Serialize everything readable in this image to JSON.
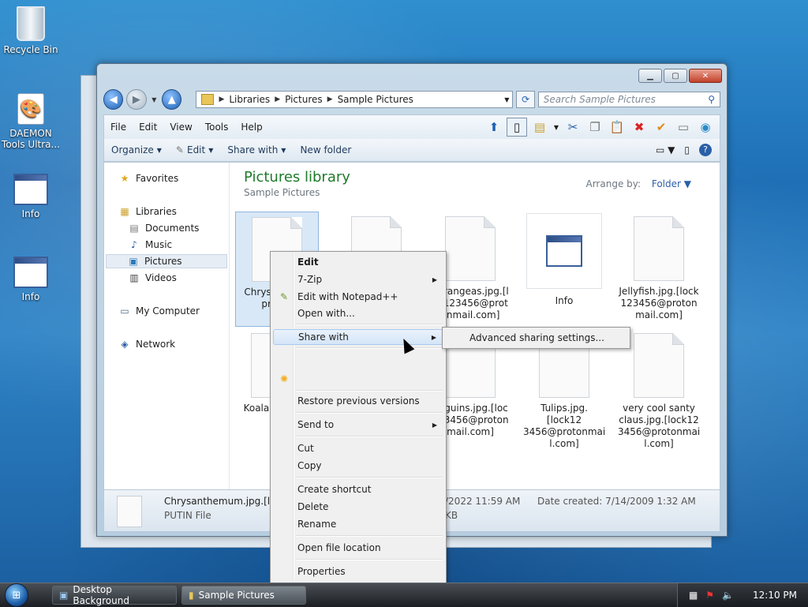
{
  "desktop": {
    "icons": [
      {
        "label": "Recycle Bin"
      },
      {
        "label": "DAEMON Tools Ultra..."
      },
      {
        "label": "Info"
      },
      {
        "label": "Info"
      }
    ]
  },
  "window": {
    "address": {
      "crumbs": [
        "Libraries",
        "Pictures",
        "Sample Pictures"
      ]
    },
    "search_placeholder": "Search Sample Pictures",
    "menu": [
      "File",
      "Edit",
      "View",
      "Tools",
      "Help"
    ],
    "commands": {
      "organize": "Organize",
      "edit": "Edit",
      "share": "Share with",
      "new_folder": "New folder"
    },
    "nav": {
      "favorites": "Favorites",
      "libraries": "Libraries",
      "documents": "Documents",
      "music": "Music",
      "pictures": "Pictures",
      "videos": "Videos",
      "computer": "My Computer",
      "network": "Network"
    },
    "library_title": "Pictures library",
    "library_sub": "Sample Pictures",
    "arrange_label": "Arrange by:",
    "arrange_value": "Folder",
    "files": {
      "chrys": "Chrysa jpg.[lo proton",
      "hydr": "ydrangeas.jpg.[l ck123456@prot onmail.com]",
      "info": "Info",
      "jelly": "Jellyfish.jpg.[lock 123456@proton mail.com]",
      "koala": "Koala. 3456@",
      "peng": "enguins.jpg.[loc 123456@proton mail.com]",
      "tulips": "Tulips.jpg.[lock12 3456@protonmai l.com]",
      "santa": "very cool santy claus.jpg.[lock12 3456@protonmai l.com]"
    },
    "details": {
      "name": "Chrysanthemum.jpg.[loc",
      "type": "PUTIN File",
      "modified": "/2022 11:59 AM",
      "size": "KB",
      "created": "Date created:  7/14/2009 1:32 AM"
    }
  },
  "context_menu": {
    "edit": "Edit",
    "zip": "7-Zip",
    "notepad": "Edit with Notepad++",
    "open_with": "Open with...",
    "share_with": "Share with",
    "restore": "Restore previous versions",
    "send_to": "Send to",
    "cut": "Cut",
    "copy": "Copy",
    "shortcut": "Create shortcut",
    "delete": "Delete",
    "rename": "Rename",
    "open_location": "Open file location",
    "properties": "Properties"
  },
  "submenu": {
    "advanced": "Advanced sharing settings..."
  },
  "taskbar": {
    "items": [
      "Desktop Background",
      "Sample Pictures"
    ],
    "clock": "12:10 PM"
  }
}
